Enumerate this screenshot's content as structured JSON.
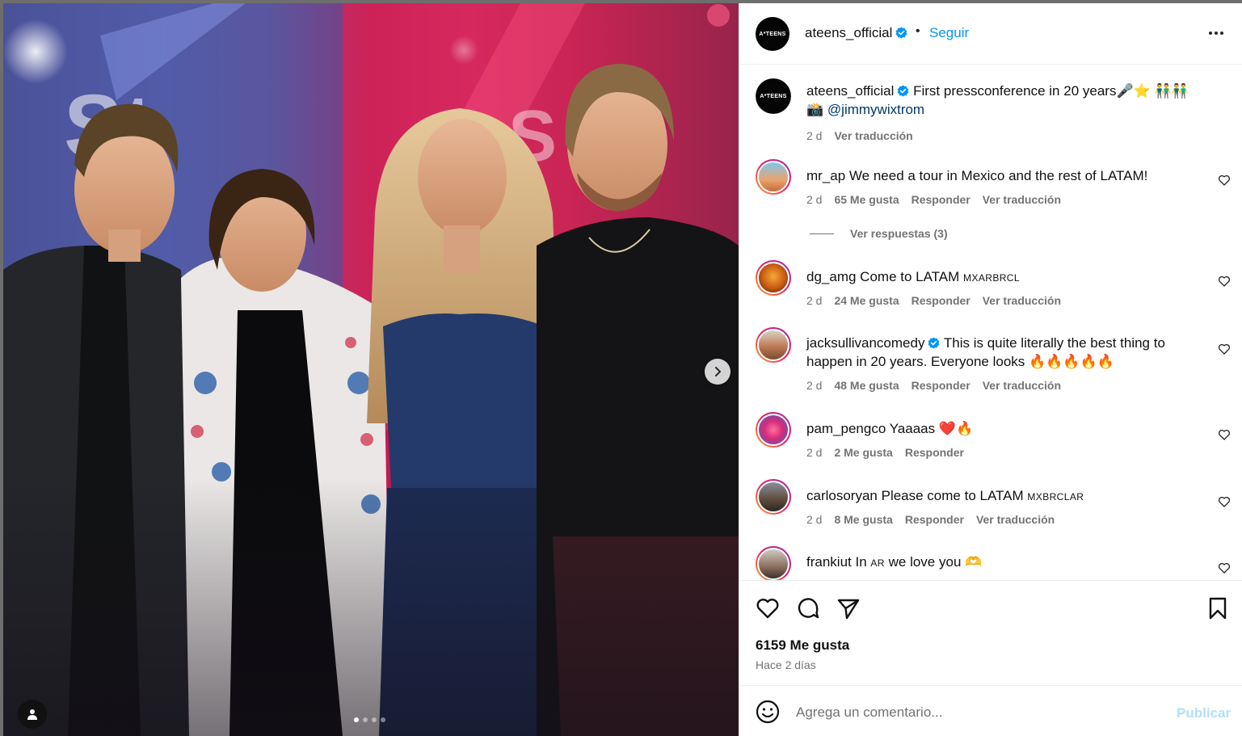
{
  "post": {
    "username": "ateens_official",
    "verified": true,
    "separator": "•",
    "follow_label": "Seguir",
    "avatar_logo_text": "A*TEENS",
    "more_icon": "more-horizontal-icon"
  },
  "media": {
    "carousel_dots": 4,
    "active_dot": 0,
    "next_icon": "chevron-right-icon",
    "tag_icon": "user-tag-icon"
  },
  "caption": {
    "username": "ateens_official",
    "text": "First pressconference in 20 years🎤⭐ 👬👬",
    "camera": "📸",
    "mention": "@jimmywixtrom",
    "time": "2 d",
    "translate": "Ver traducción"
  },
  "comments": [
    {
      "username": "mr_ap",
      "text": "We need a tour in Mexico and the rest of LATAM!",
      "time": "2 d",
      "likes": "65 Me gusta",
      "reply": "Responder",
      "translate": "Ver traducción"
    },
    {
      "username": "dg_amg",
      "text": "Come to LATAM",
      "flags": "MXARBRCL",
      "time": "2 d",
      "likes": "24 Me gusta",
      "reply": "Responder",
      "translate": "Ver traducción"
    },
    {
      "username": "jacksullivancomedy",
      "verified": true,
      "text": "This is quite literally the best thing to happen in 20 years. Everyone looks 🔥🔥🔥🔥🔥",
      "time": "2 d",
      "likes": "48 Me gusta",
      "reply": "Responder",
      "translate": "Ver traducción"
    },
    {
      "username": "pam_pengco",
      "text": "Yaaaas ❤️🔥",
      "time": "2 d",
      "likes": "2 Me gusta",
      "reply": "Responder"
    },
    {
      "username": "carlosoryan",
      "text": "Please come to LATAM",
      "flags": "MXBRCLAR",
      "time": "2 d",
      "likes": "8 Me gusta",
      "reply": "Responder",
      "translate": "Ver traducción"
    },
    {
      "username": "frankiut",
      "text_before": "In",
      "flag": "AR",
      "text_after": "we love you 🫶"
    }
  ],
  "replies_link": "Ver respuestas (3)",
  "actions": {
    "like_icon": "heart-icon",
    "comment_icon": "comment-icon",
    "share_icon": "send-icon",
    "save_icon": "bookmark-icon"
  },
  "likes_total": "6159 Me gusta",
  "posted": "Hace 2 días",
  "composer": {
    "placeholder": "Agrega un comentario...",
    "publish_label": "Publicar",
    "emoji_icon": "emoji-icon"
  },
  "colors": {
    "link": "#0095f6",
    "meta_gray": "#737373",
    "verified_blue": "#0095f6"
  }
}
